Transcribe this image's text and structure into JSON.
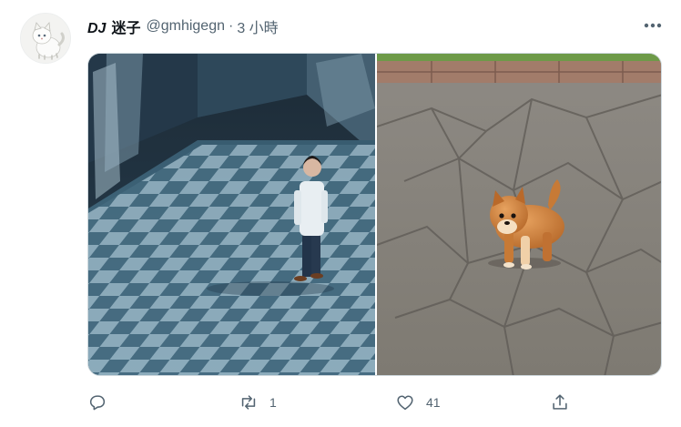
{
  "author": {
    "display_name_latin": "DJ",
    "display_name_cjk": "迷子",
    "handle": "@gmhigegn",
    "separator": "·",
    "time": "3 小時"
  },
  "icons": {
    "avatar": "white-kitten-avatar",
    "more": "more-horizontal-icon",
    "reply": "reply-icon",
    "retweet": "retweet-icon",
    "like": "heart-icon",
    "share": "share-icon"
  },
  "media": [
    {
      "name": "person-on-checkered-floor-photo"
    },
    {
      "name": "shiba-puppy-on-stone-pavement-photo"
    }
  ],
  "actions": {
    "reply_count": "",
    "retweet_count": "1",
    "like_count": "41"
  },
  "colors": {
    "text": "#0f1419",
    "secondary": "#536471",
    "border": "#cfd9de"
  }
}
